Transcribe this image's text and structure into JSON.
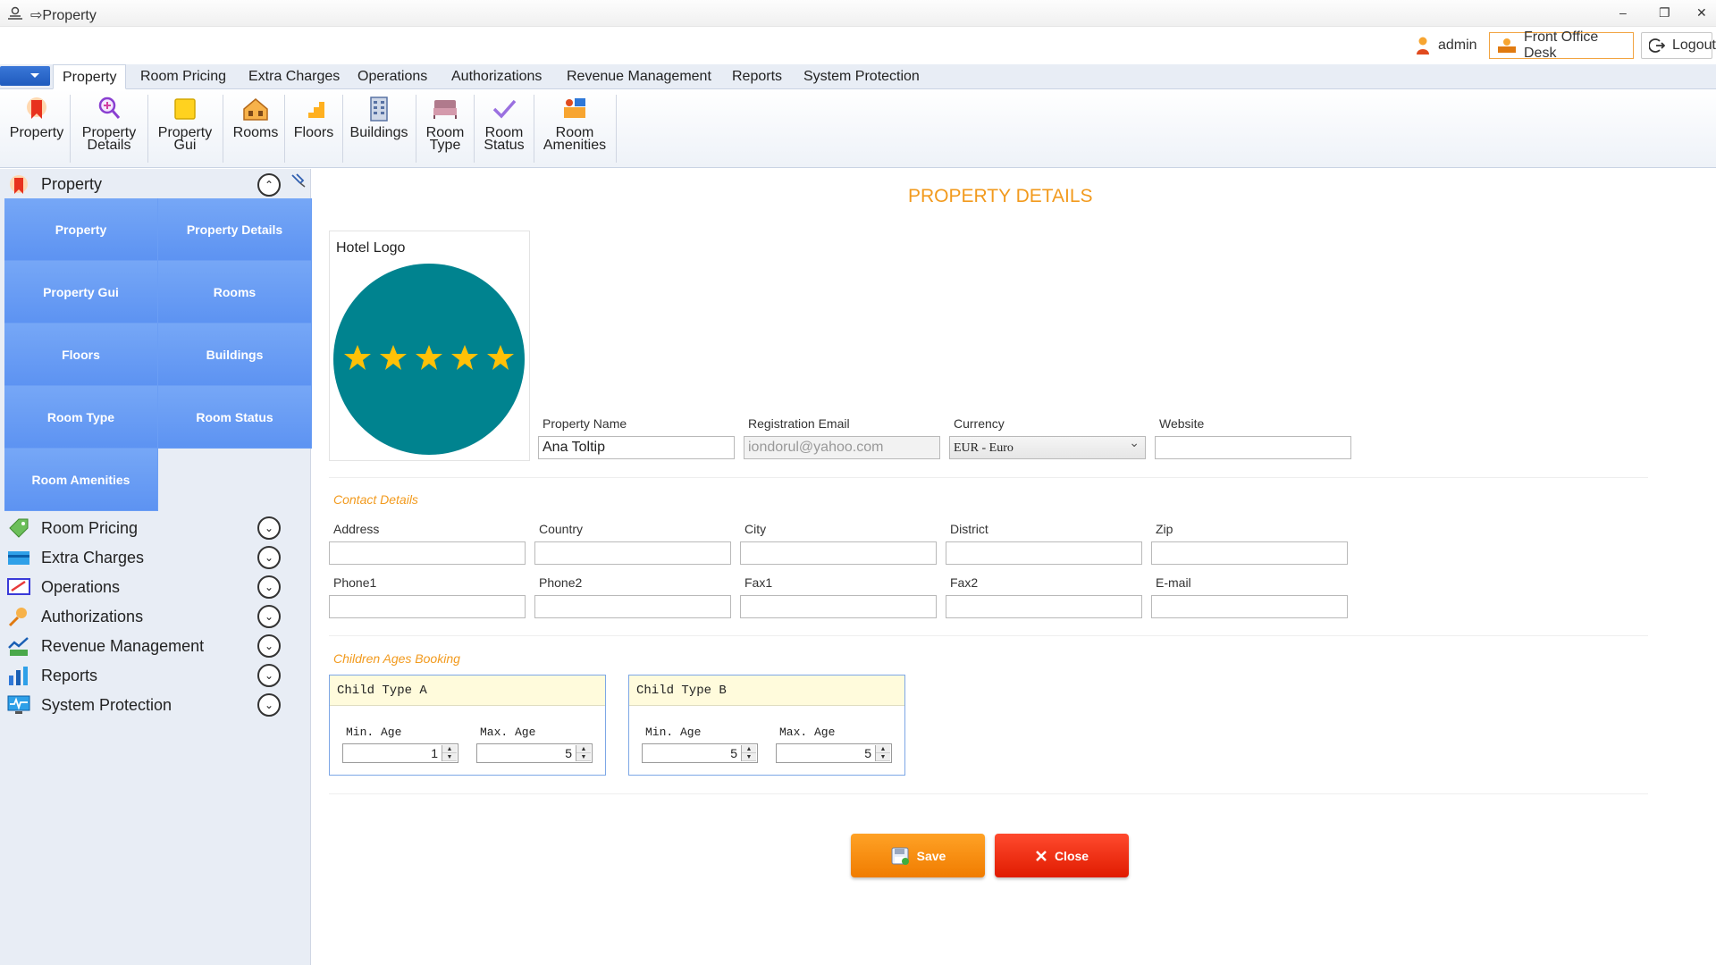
{
  "window": {
    "title": "⇨Property",
    "minimize_glyph": "–",
    "restore_glyph": "❐",
    "close_glyph": "✕"
  },
  "userbar": {
    "user": "admin",
    "desk": "Front Office Desk",
    "logout": "Logout"
  },
  "tabs": [
    "Property",
    "Room Pricing",
    "Extra Charges",
    "Operations",
    "Authorizations",
    "Revenue Management",
    "Reports",
    "System Protection"
  ],
  "ribbon": {
    "property": "Property",
    "property_details": [
      "Property",
      "Details"
    ],
    "property_gui": [
      "Property",
      "Gui"
    ],
    "rooms": "Rooms",
    "floors": "Floors",
    "buildings": "Buildings",
    "room_type": [
      "Room",
      "Type"
    ],
    "room_status": [
      "Room",
      "Status"
    ],
    "room_amenities": [
      "Room",
      "Amenities"
    ]
  },
  "sidebar": {
    "header": "Property",
    "tiles": [
      "Property",
      "Property Details",
      "Property Gui",
      "Rooms",
      "Floors",
      "Buildings",
      "Room Type",
      "Room Status",
      "Room Amenities"
    ],
    "groups": [
      "Room Pricing",
      "Extra Charges",
      "Operations",
      "Authorizations",
      "Revenue Management",
      "Reports",
      "System Protection"
    ],
    "collapse_glyph": "⌃",
    "expand_glyph": "⌄"
  },
  "page": {
    "title": "PROPERTY DETAILS",
    "hotel_logo_label": "Hotel Logo",
    "fields": {
      "property_name": {
        "label": "Property Name",
        "value": "Ana Toltip"
      },
      "registration_email": {
        "label": "Registration Email",
        "value": "iondorul@yahoo.com"
      },
      "currency": {
        "label": "Currency",
        "value": "EUR - Euro"
      },
      "website": {
        "label": "Website",
        "value": ""
      }
    },
    "contact_section": "Contact Details",
    "contact_labels": {
      "address": "Address",
      "country": "Country",
      "city": "City",
      "district": "District",
      "zip": "Zip",
      "phone1": "Phone1",
      "phone2": "Phone2",
      "fax1": "Fax1",
      "fax2": "Fax2",
      "email": "E-mail"
    },
    "children_section": "Children Ages Booking",
    "child_a": {
      "title": "Child Type A",
      "min_label": "Min. Age",
      "max_label": "Max. Age",
      "min": "1",
      "max": "5"
    },
    "child_b": {
      "title": "Child Type B",
      "min_label": "Min. Age",
      "max_label": "Max. Age",
      "min": "5",
      "max": "5"
    },
    "save": "Save",
    "close": "Close"
  },
  "colors": {
    "accent": "#f29a1d",
    "tile": "#6b9ef4",
    "logo_circle": "#00838f",
    "star": "#ffc107",
    "save": "#f88e10",
    "close": "#f0300f"
  }
}
